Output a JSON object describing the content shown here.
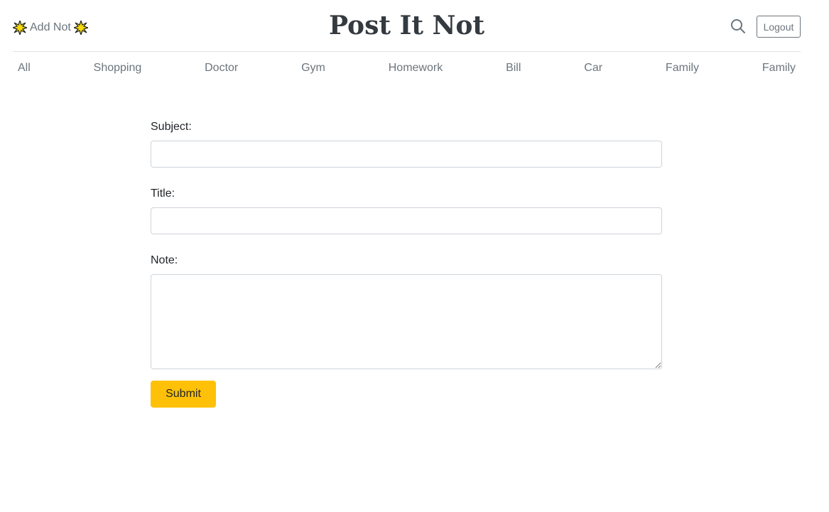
{
  "header": {
    "add_label": "Add Not",
    "brand": "Post It Not",
    "search_icon": "search-icon",
    "logout_label": "Logout"
  },
  "nav": {
    "items": [
      {
        "label": "All"
      },
      {
        "label": "Shopping"
      },
      {
        "label": "Doctor"
      },
      {
        "label": "Gym"
      },
      {
        "label": "Homework"
      },
      {
        "label": "Bill"
      },
      {
        "label": "Car"
      },
      {
        "label": "Family"
      },
      {
        "label": "Family"
      }
    ]
  },
  "form": {
    "subject_label": "Subject:",
    "subject_value": "",
    "title_label": "Title:",
    "title_value": "",
    "note_label": "Note:",
    "note_value": "",
    "submit_label": "Submit"
  },
  "colors": {
    "accent": "#ffc107",
    "muted": "#6c757d",
    "brand": "#343a40",
    "burst": "#f5d90a"
  }
}
